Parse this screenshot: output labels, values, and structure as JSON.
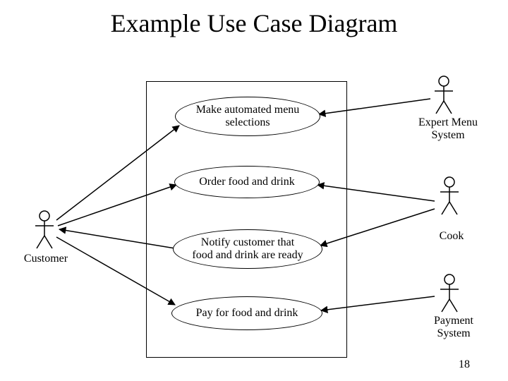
{
  "title": "Example Use Case Diagram",
  "usecases": {
    "uc1": "Make automated menu\nselections",
    "uc2": "Order food and drink",
    "uc3": "Notify customer that\nfood and drink are ready",
    "uc4": "Pay for food and drink"
  },
  "actors": {
    "customer": "Customer",
    "expert": "Expert Menu\nSystem",
    "cook": "Cook",
    "payment": "Payment\nSystem"
  },
  "slide_number": "18"
}
